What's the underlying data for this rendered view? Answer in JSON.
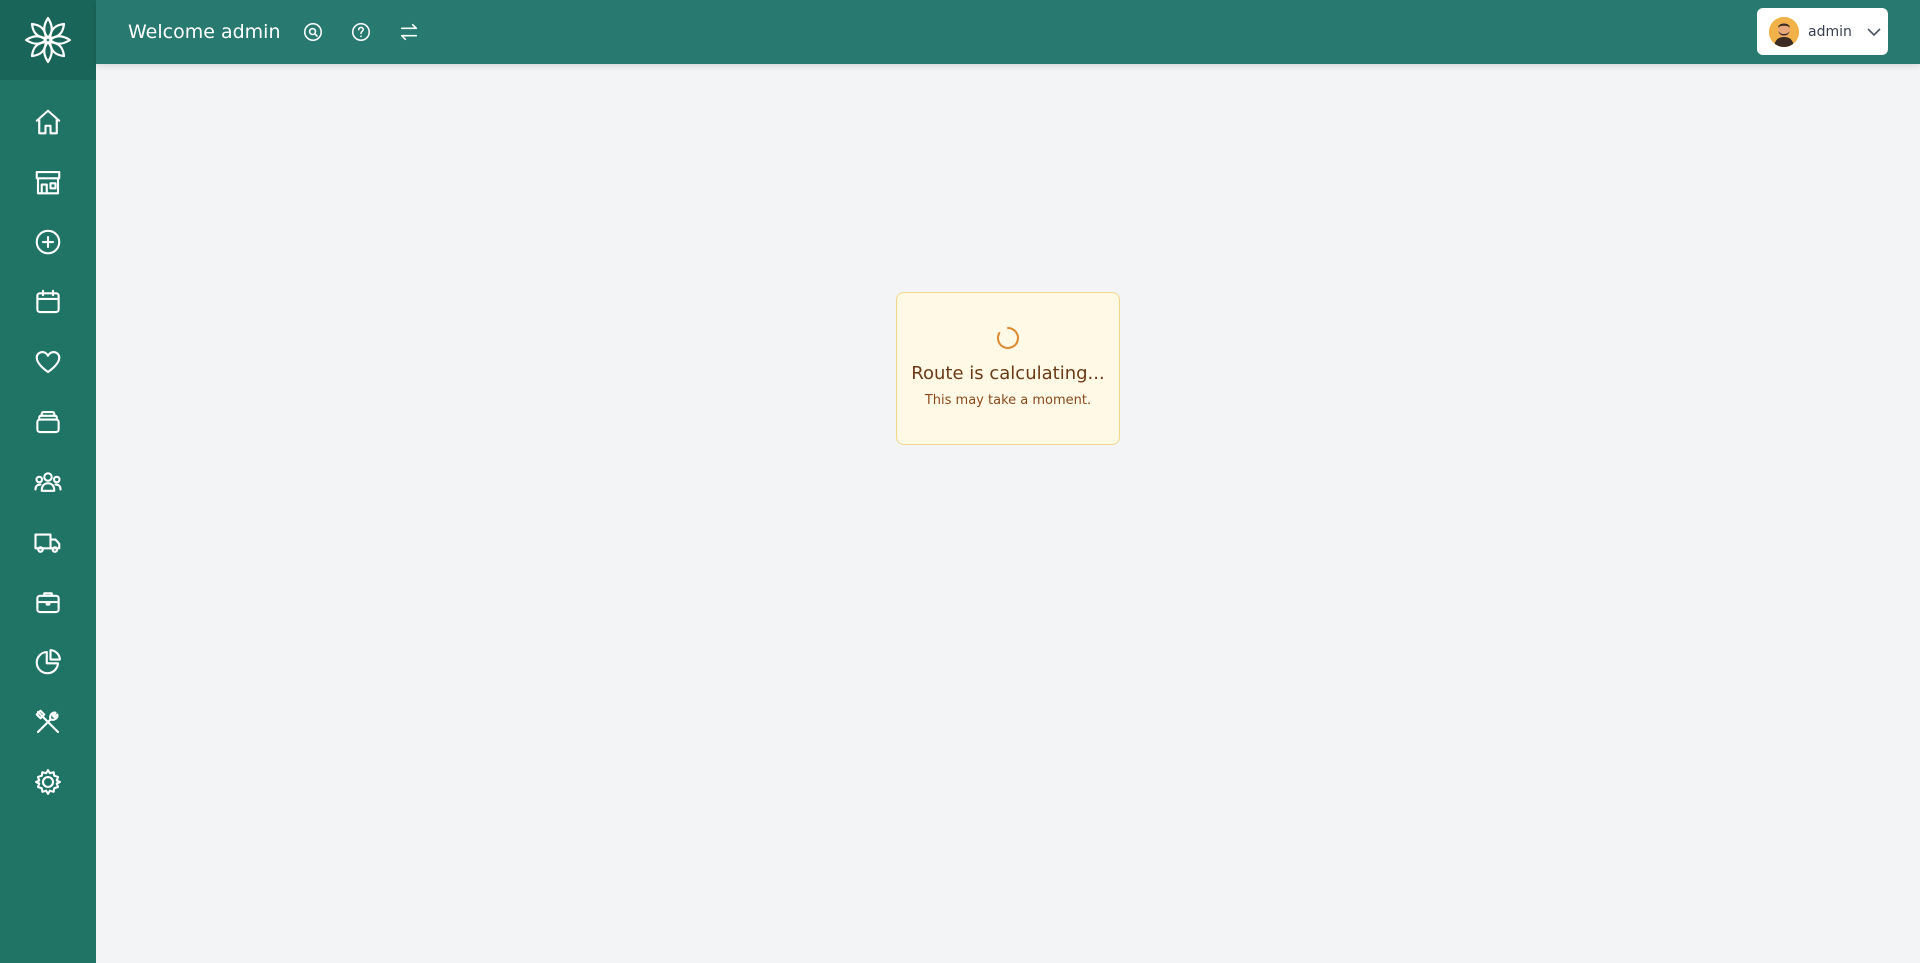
{
  "header": {
    "welcome_text": "Welcome admin",
    "icons": [
      "search-icon",
      "help-icon",
      "switch-icon"
    ]
  },
  "user_menu": {
    "name": "admin",
    "avatar_icon": "avatar"
  },
  "sidebar": {
    "logo_icon": "flower-logo-icon",
    "items": [
      {
        "icon": "home-icon"
      },
      {
        "icon": "store-icon"
      },
      {
        "icon": "plus-circle-icon"
      },
      {
        "icon": "calendar-icon"
      },
      {
        "icon": "heart-icon"
      },
      {
        "icon": "layers-icon"
      },
      {
        "icon": "users-icon"
      },
      {
        "icon": "truck-icon"
      },
      {
        "icon": "briefcase-icon"
      },
      {
        "icon": "pie-chart-icon"
      },
      {
        "icon": "tools-icon"
      },
      {
        "icon": "settings-icon"
      }
    ]
  },
  "loading": {
    "title": "Route is calculating...",
    "subtitle": "This may take a moment."
  },
  "colors": {
    "sidebar": "#207466",
    "topbar": "#287a70",
    "background": "#f3f4f6",
    "card_bg": "#fff9e6",
    "card_border": "#f7d58a",
    "spinner": "#e0892c",
    "title_text": "#6b3a16"
  }
}
